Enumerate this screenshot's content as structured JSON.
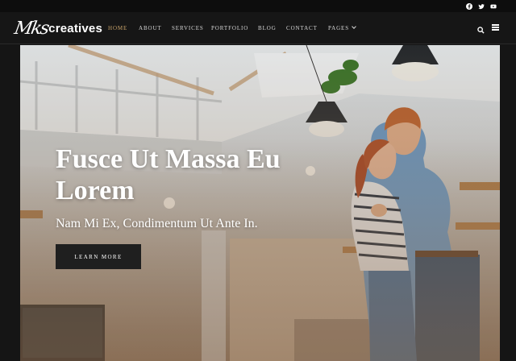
{
  "topbar": {
    "social": [
      {
        "name": "facebook-icon"
      },
      {
        "name": "twitter-icon"
      },
      {
        "name": "youtube-icon"
      }
    ]
  },
  "brand": {
    "script_part": "Mks",
    "word_part": "creatives"
  },
  "nav": {
    "items": [
      {
        "label": "HOME",
        "active": true
      },
      {
        "label": "ABOUT"
      },
      {
        "label": "SERVICES"
      },
      {
        "label": "PORTFOLIO"
      },
      {
        "label": "BLOG"
      },
      {
        "label": "CONTACT"
      },
      {
        "label": "PAGES"
      }
    ],
    "icons": [
      "search-icon",
      "menu-icon"
    ]
  },
  "hero": {
    "title": "Fusce Ut Massa Eu Lorem",
    "subtitle": "Nam Mi Ex, Condimentum Ut Ante In.",
    "button_label": "LEARN MORE"
  },
  "colors": {
    "accent": "#c9a36a",
    "nav_bg": "#161616",
    "topbar_bg": "#0d0d0d",
    "button_bg": "#1f1f1f"
  }
}
